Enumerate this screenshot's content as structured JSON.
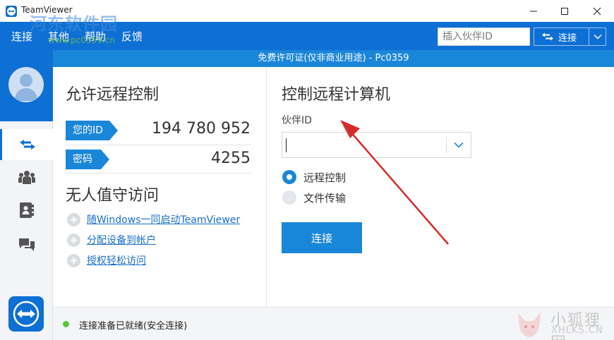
{
  "window": {
    "title": "TeamViewer"
  },
  "menu": {
    "items": [
      "连接",
      "其他",
      "帮助",
      "反馈"
    ],
    "partner_input_placeholder": "插入伙伴ID",
    "connect_label": "连接"
  },
  "license": {
    "text": "免费许可证(仅非商业用途) - Pc0359"
  },
  "allow_remote": {
    "title": "允许远程控制",
    "id_label": "您的ID",
    "id_value": "194 780 952",
    "password_label": "密码",
    "password_value": "4255"
  },
  "unattended": {
    "title": "无人值守访问",
    "items": [
      "随Windows一同启动TeamViewer",
      "分配设备到帐户",
      "授权轻松访问"
    ]
  },
  "control_remote": {
    "title": "控制远程计算机",
    "partner_label": "伙伴ID",
    "partner_value": "",
    "options": [
      {
        "label": "远程控制",
        "checked": true
      },
      {
        "label": "文件传输",
        "checked": false
      }
    ],
    "connect_label": "连接"
  },
  "status": {
    "text": "连接准备已就绪(安全连接)"
  },
  "watermarks": {
    "top_left": "河东软件园",
    "top_left_sub": "www.pc0359.cn",
    "bottom_right_cn": "小狐狸网",
    "bottom_right_en": "XHLKS.CN"
  },
  "colors": {
    "brand": "#0e6fd4",
    "accent": "#1a86d9",
    "status_ok": "#5cc33b",
    "annotation": "#d62b2b"
  },
  "icons": {
    "sidebar": [
      "remote-control-icon",
      "meeting-icon",
      "contacts-icon",
      "chat-icon"
    ]
  }
}
